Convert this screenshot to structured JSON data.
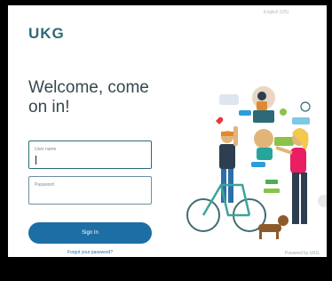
{
  "brand": {
    "logo_text": "UKG"
  },
  "header": {
    "top_link": "English (US)"
  },
  "main": {
    "welcome_text": "Welcome, come on in!",
    "username_label": "User name",
    "password_label": "Password",
    "signin_label": "Sign In",
    "forgot_label": "Forgot your password?"
  },
  "footer": {
    "powered_text": "Powered by UKG"
  },
  "colors": {
    "brand": "#2c6a78",
    "button": "#1d6ea5",
    "text": "#34484d"
  },
  "icons": [
    "people-illustration",
    "bicycle-illustration",
    "dog-illustration",
    "heart-icon",
    "chat-bubble-icon"
  ]
}
